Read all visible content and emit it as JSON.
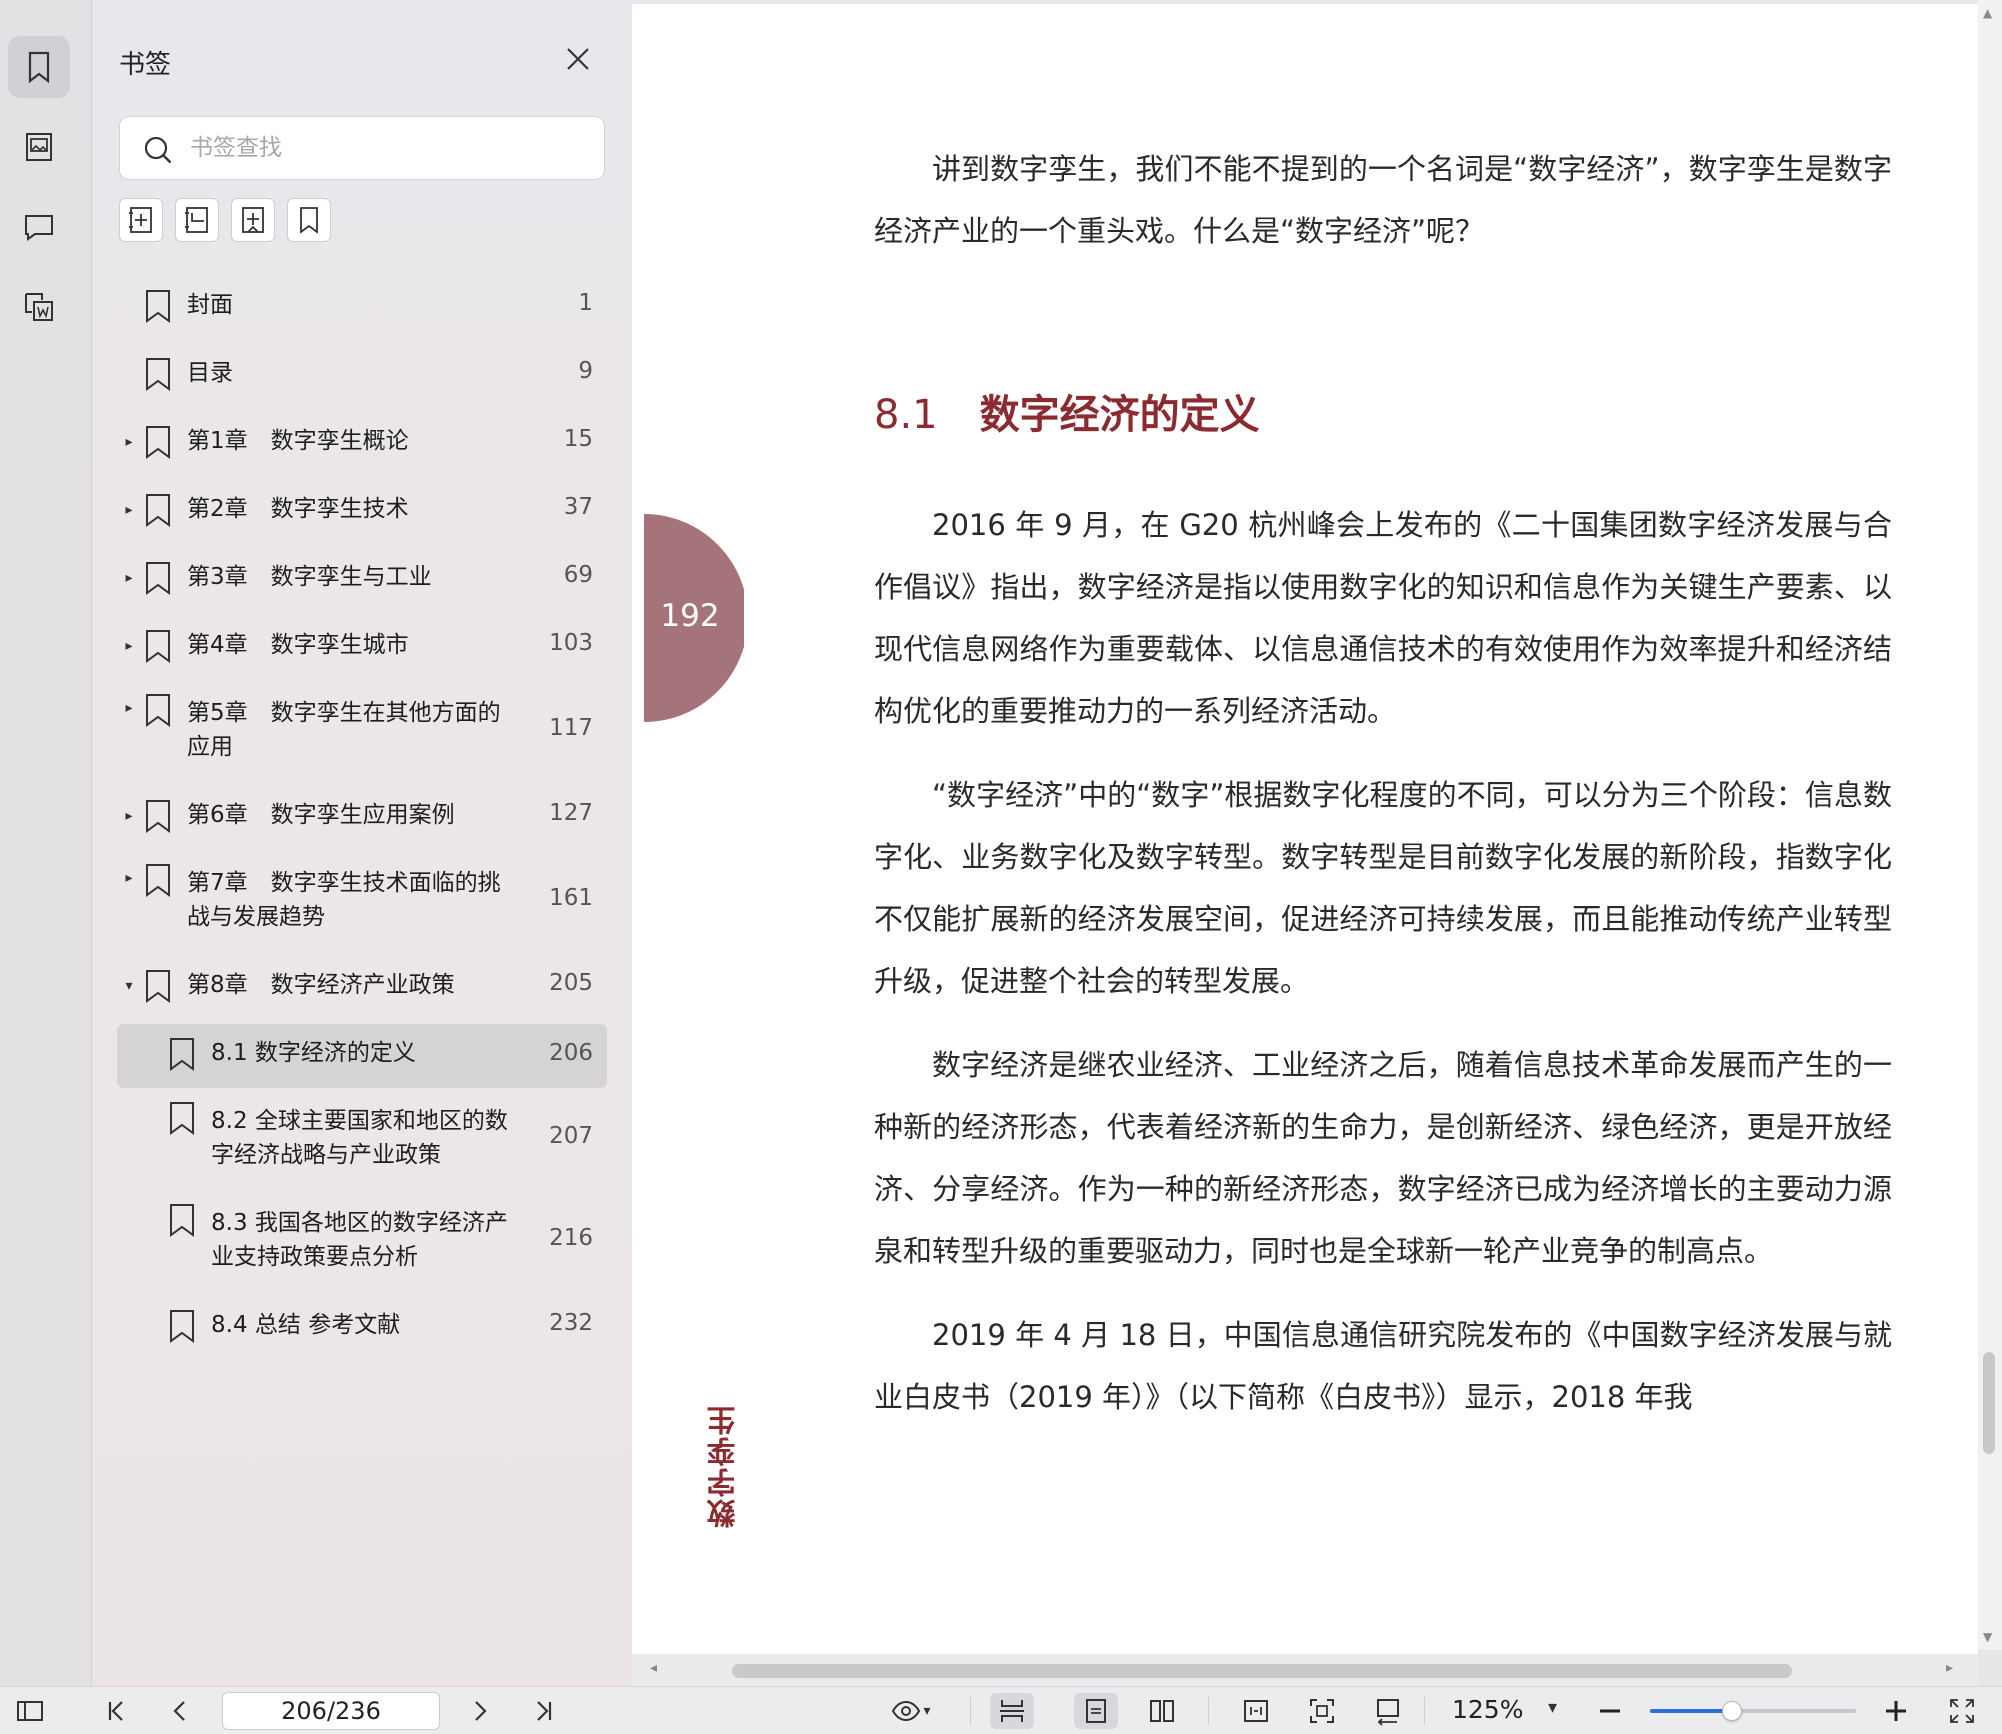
{
  "panel": {
    "title": "书签",
    "search_placeholder": "书签查找"
  },
  "bookmarks": [
    {
      "label": "封面",
      "page": "1",
      "level": 0,
      "arrow": ""
    },
    {
      "label": "目录",
      "page": "9",
      "level": 0,
      "arrow": ""
    },
    {
      "label": "第1章　数字孪生概论",
      "page": "15",
      "level": 0,
      "arrow": "▸"
    },
    {
      "label": "第2章　数字孪生技术",
      "page": "37",
      "level": 0,
      "arrow": "▸"
    },
    {
      "label": "第3章　数字孪生与工业",
      "page": "69",
      "level": 0,
      "arrow": "▸"
    },
    {
      "label": "第4章　数字孪生城市",
      "page": "103",
      "level": 0,
      "arrow": "▸"
    },
    {
      "label": "第5章　数字孪生在其他方面的\n应用",
      "page": "117",
      "level": 0,
      "arrow": "▸"
    },
    {
      "label": "第6章　数字孪生应用案例",
      "page": "127",
      "level": 0,
      "arrow": "▸"
    },
    {
      "label": "第7章　数字孪生技术面临的挑\n战与发展趋势",
      "page": "161",
      "level": 0,
      "arrow": "▸"
    },
    {
      "label": "第8章　数字经济产业政策",
      "page": "205",
      "level": 0,
      "arrow": "▾"
    },
    {
      "label": "8.1 数字经济的定义",
      "page": "206",
      "level": 1,
      "arrow": "",
      "selected": true
    },
    {
      "label": "8.2 全球主要国家和地区的数\n字经济战略与产业政策",
      "page": "207",
      "level": 1,
      "arrow": ""
    },
    {
      "label": "8.3 我国各地区的数字经济产\n业支持政策要点分析",
      "page": "216",
      "level": 1,
      "arrow": ""
    },
    {
      "label": "8.4 总结 参考文献",
      "page": "232",
      "level": 1,
      "arrow": ""
    }
  ],
  "document": {
    "page_badge": "192",
    "side_label": "数字孪生",
    "intro": "讲到数字孪生，我们不能不提到的一个名词是“数字经济”，数字孪生是数字经济产业的一个重头戏。什么是“数字经济”呢？",
    "heading_number": "8.1",
    "heading_title": "数字经济的定义",
    "para1": "2016 年 9 月，在 G20 杭州峰会上发布的《二十国集团数字经济发展与合作倡议》指出，数字经济是指以使用数字化的知识和信息作为关键生产要素、以现代信息网络作为重要载体、以信息通信技术的有效使用作为效率提升和经济结构优化的重要推动力的一系列经济活动。",
    "para2": "“数字经济”中的“数字”根据数字化程度的不同，可以分为三个阶段：信息数字化、业务数字化及数字转型。数字转型是目前数字化发展的新阶段，指数字化不仅能扩展新的经济发展空间，促进经济可持续发展，而且能推动传统产业转型升级，促进整个社会的转型发展。",
    "para3": "数字经济是继农业经济、工业经济之后，随着信息技术革命发展而产生的一种新的经济形态，代表着经济新的生命力，是创新经济、绿色经济，更是开放经济、分享经济。作为一种的新经济形态，数字经济已成为经济增长的主要动力源泉和转型升级的重要驱动力，同时也是全球新一轮产业竞争的制高点。",
    "para4": "2019 年 4 月 18 日，中国信息通信研究院发布的《中国数字经济发展与就业白皮书（2019 年）》（以下简称《白皮书》）显示，2018 年我"
  },
  "toolbar": {
    "page_indicator": "206/236",
    "zoom": "125%",
    "zoom_slider_fraction": 0.4
  },
  "colors": {
    "accent_red": "#8b2b2f",
    "badge": "#a5737a",
    "slider_blue": "#2b6fdd"
  }
}
